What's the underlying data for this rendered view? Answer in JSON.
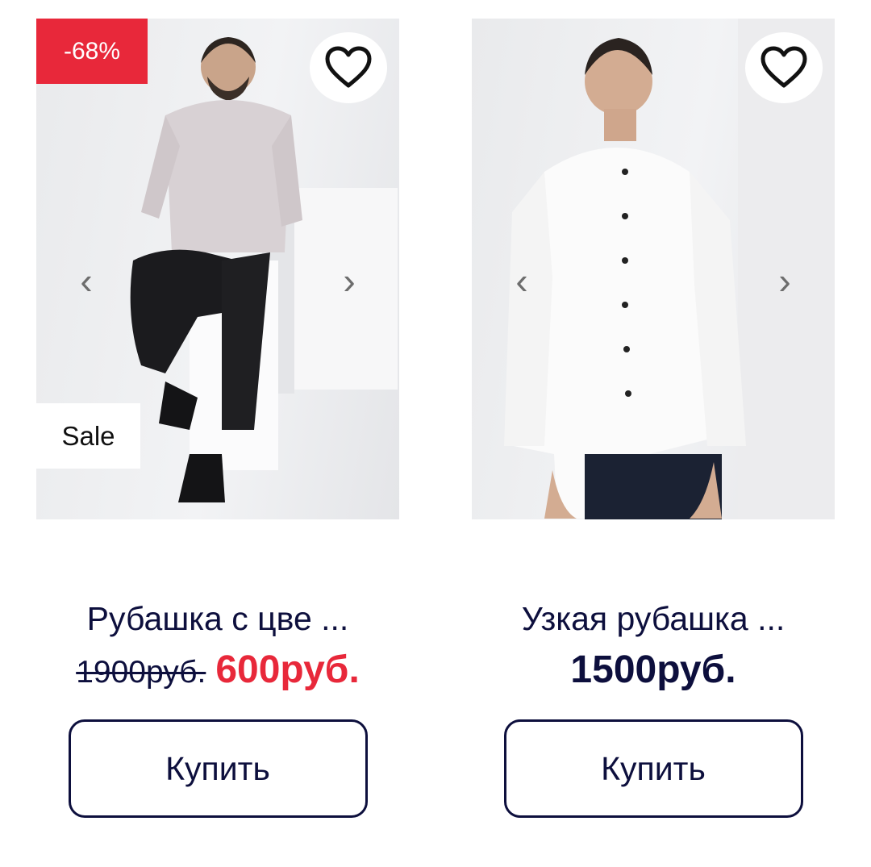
{
  "products": [
    {
      "discount_badge": "-68%",
      "sale_badge": "Sale",
      "title": "Рубашка с цве ...",
      "old_price": "1900руб.",
      "price": "600руб.",
      "buy_label": "Купить",
      "prev_arrow": "‹",
      "next_arrow": "›"
    },
    {
      "title": "Узкая рубашка ...",
      "price": "1500руб.",
      "buy_label": "Купить",
      "prev_arrow": "‹",
      "next_arrow": "›"
    }
  ],
  "colors": {
    "accent_red": "#e8283a",
    "text_navy": "#0d0f3d"
  },
  "icons": {
    "favorite": "heart-outline-icon",
    "prev": "chevron-left-icon",
    "next": "chevron-right-icon"
  }
}
